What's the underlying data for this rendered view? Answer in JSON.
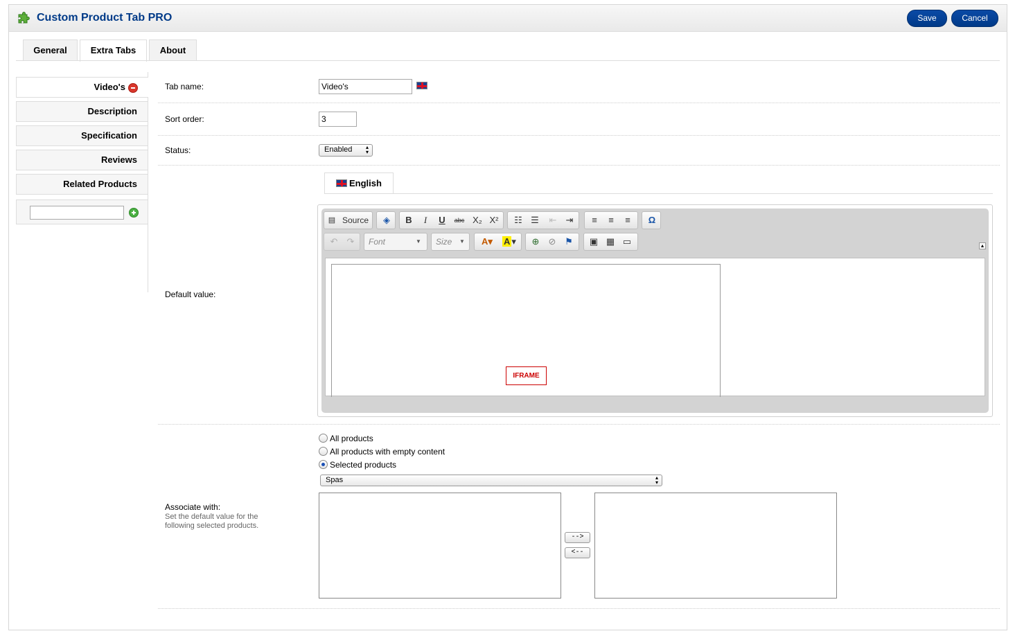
{
  "header": {
    "title": "Custom Product Tab PRO",
    "save_label": "Save",
    "cancel_label": "Cancel"
  },
  "tabs": [
    {
      "label": "General"
    },
    {
      "label": "Extra Tabs"
    },
    {
      "label": "About"
    }
  ],
  "extra_tabs": [
    {
      "label": "Video's"
    },
    {
      "label": "Description"
    },
    {
      "label": "Specification"
    },
    {
      "label": "Reviews"
    },
    {
      "label": "Related Products"
    }
  ],
  "form": {
    "tab_name_label": "Tab name:",
    "tab_name_value": "Video's",
    "sort_order_label": "Sort order:",
    "sort_order_value": "3",
    "status_label": "Status:",
    "status_value": "Enabled",
    "default_value_label": "Default value:",
    "language_tab": "English",
    "associate_label": "Associate with:",
    "associate_help": "Set the default value for the following selected products.",
    "radio_options": [
      "All products",
      "All products with empty content",
      "Selected products"
    ],
    "selected_radio": "Selected products",
    "category_value": "Spas",
    "move_right_label": "-->",
    "move_left_label": "<--"
  },
  "editor": {
    "source_label": "Source",
    "bold": "B",
    "italic": "I",
    "underline": "U",
    "strike": "abc",
    "subscript": "X₂",
    "superscript": "X²",
    "font_placeholder": "Font",
    "size_placeholder": "Size",
    "iframe_label": "IFRAME"
  },
  "colors": {
    "brand_blue": "#003a88",
    "remove_red": "#d9362b",
    "add_green": "#4bb043"
  }
}
